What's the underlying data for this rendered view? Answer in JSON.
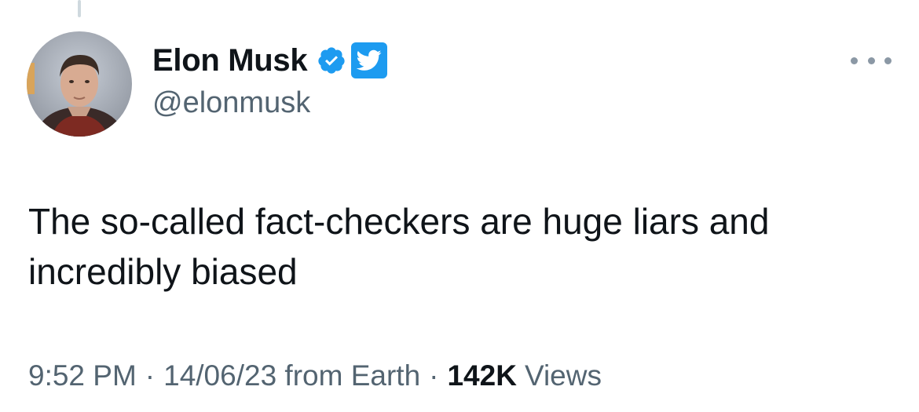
{
  "tweet": {
    "author": {
      "display_name": "Elon Musk",
      "handle": "@elonmusk",
      "avatar_icon": "profile-photo",
      "verified_icon": "verified-badge-icon",
      "affiliation_icon": "twitter-bird-icon"
    },
    "text": "The so-called fact-checkers are huge liars and incredibly biased",
    "meta": {
      "time": "9:52 PM",
      "separator": "·",
      "date_source": "14/06/23 from Earth",
      "views_count": "142K",
      "views_label": "Views"
    },
    "more_icon": "more-options-icon"
  },
  "colors": {
    "text_primary": "#0f1419",
    "text_secondary": "#536471",
    "brand_blue": "#1d9bf0",
    "thread_line": "#cfd9de"
  }
}
